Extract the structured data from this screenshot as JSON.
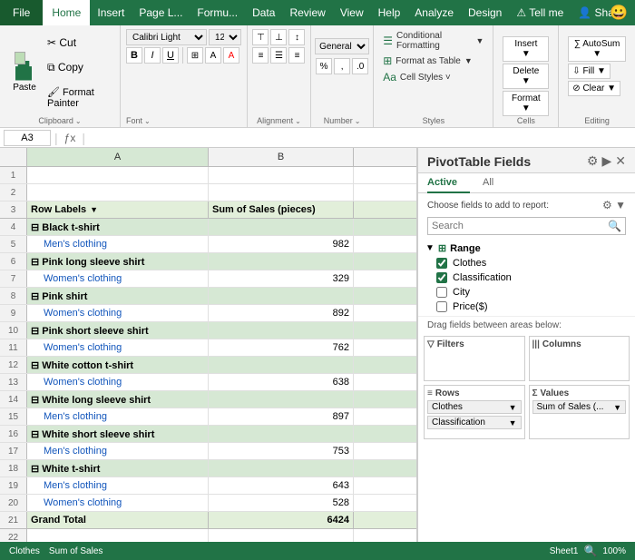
{
  "menubar": {
    "file": "File",
    "items": [
      "Home",
      "Insert",
      "Page L...",
      "Formu...",
      "Data",
      "Review",
      "View",
      "Help",
      "Analyze",
      "Design",
      "Tell me",
      "Share"
    ]
  },
  "ribbon": {
    "clipboard": {
      "label": "Clipboard",
      "paste": "Paste",
      "cut": "✂",
      "copy": "⧉",
      "format_painter": "🖌"
    },
    "font": {
      "label": "Font",
      "name": "Calibri Light",
      "size": "12",
      "bold": "B",
      "italic": "I",
      "underline": "U",
      "increase": "A↑",
      "decrease": "A↓"
    },
    "alignment": {
      "label": "Alignment"
    },
    "number": {
      "label": "Number"
    },
    "styles": {
      "label": "Styles",
      "conditional": "Conditional Formatting",
      "format_as": "Format as Table",
      "cell_styles": "Cell Styles ˅"
    },
    "cells": {
      "label": "Cells"
    },
    "editing": {
      "label": "Editing"
    }
  },
  "formula_bar": {
    "name_box": "A3",
    "formula": ""
  },
  "sheet": {
    "columns": [
      "A",
      "B"
    ],
    "rows": [
      {
        "num": 1,
        "a": "",
        "b": "",
        "type": "empty"
      },
      {
        "num": 2,
        "a": "",
        "b": "",
        "type": "empty"
      },
      {
        "num": 3,
        "a": "Row Labels",
        "b": "Sum of Sales (pieces)",
        "type": "label"
      },
      {
        "num": 4,
        "a": "⊟ Black t-shirt",
        "b": "",
        "type": "category"
      },
      {
        "num": 5,
        "a": "   Men's clothing",
        "b": "982",
        "type": "item"
      },
      {
        "num": 6,
        "a": "⊟ Pink long sleeve shirt",
        "b": "",
        "type": "category"
      },
      {
        "num": 7,
        "a": "   Women's clothing",
        "b": "329",
        "type": "item"
      },
      {
        "num": 8,
        "a": "⊟ Pink shirt",
        "b": "",
        "type": "category"
      },
      {
        "num": 9,
        "a": "   Women's clothing",
        "b": "892",
        "type": "item"
      },
      {
        "num": 10,
        "a": "⊟ Pink short sleeve shirt",
        "b": "",
        "type": "category"
      },
      {
        "num": 11,
        "a": "   Women's clothing",
        "b": "762",
        "type": "item"
      },
      {
        "num": 12,
        "a": "⊟ White cotton t-shirt",
        "b": "",
        "type": "category"
      },
      {
        "num": 13,
        "a": "   Women's clothing",
        "b": "638",
        "type": "item"
      },
      {
        "num": 14,
        "a": "⊟ White long sleeve shirt",
        "b": "",
        "type": "category"
      },
      {
        "num": 15,
        "a": "   Men's clothing",
        "b": "897",
        "type": "item"
      },
      {
        "num": 16,
        "a": "⊟ White short sleeve shirt",
        "b": "",
        "type": "category"
      },
      {
        "num": 17,
        "a": "   Men's clothing",
        "b": "753",
        "type": "item"
      },
      {
        "num": 18,
        "a": "⊟ White t-shirt",
        "b": "",
        "type": "category"
      },
      {
        "num": 19,
        "a": "   Men's clothing",
        "b": "643",
        "type": "item"
      },
      {
        "num": 20,
        "a": "   Women's clothing",
        "b": "528",
        "type": "item"
      },
      {
        "num": 21,
        "a": "Grand Total",
        "b": "6424",
        "type": "grand"
      },
      {
        "num": 22,
        "a": "",
        "b": "",
        "type": "empty"
      }
    ]
  },
  "pivot": {
    "title": "PivotTable Fields",
    "tabs": [
      "Active",
      "All"
    ],
    "active_tab": "Active",
    "description": "Choose fields to add to report:",
    "search_placeholder": "Search",
    "range_label": "Range",
    "fields": [
      {
        "name": "Clothes",
        "checked": true
      },
      {
        "name": "Classification",
        "checked": true
      },
      {
        "name": "City",
        "checked": false
      },
      {
        "name": "Price($)",
        "checked": false
      }
    ],
    "drag_label": "Drag fields between areas below:",
    "areas": {
      "filters": {
        "label": "Filters",
        "icon": "▽",
        "items": []
      },
      "columns": {
        "label": "Columns",
        "icon": "|||",
        "items": []
      },
      "rows": {
        "label": "Rows",
        "icon": "≡",
        "items": [
          "Clothes",
          "Classification"
        ]
      },
      "values": {
        "label": "Values",
        "icon": "Σ",
        "items": [
          "Sum of Sales (..."
        ]
      }
    }
  },
  "status_bar": {
    "items": [
      "Clothes",
      "Sum of Sales"
    ],
    "sheet_tab": "Sheet1"
  }
}
